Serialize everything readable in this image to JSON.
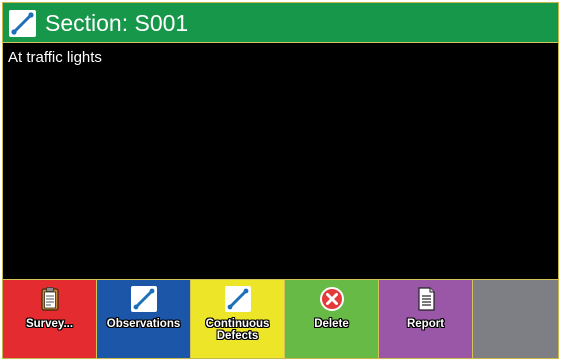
{
  "header": {
    "title": "Section: S001",
    "icon": "edit-line-icon"
  },
  "content": {
    "text": "At traffic lights"
  },
  "toolbar": {
    "buttons": [
      {
        "label": "Survey...",
        "icon": "clipboard-icon",
        "color": "#e42b2f"
      },
      {
        "label": "Observations",
        "icon": "edit-line-icon",
        "color": "#1c56a8"
      },
      {
        "label": "Continuous\nDefects",
        "icon": "edit-line-icon",
        "color": "#ede628"
      },
      {
        "label": "Delete",
        "icon": "delete-x-icon",
        "color": "#66ba45"
      },
      {
        "label": "Report",
        "icon": "document-icon",
        "color": "#9a56a7"
      }
    ],
    "empty_color": "#7d7f84"
  },
  "colors": {
    "header_bg": "#17974a",
    "content_bg": "#000000",
    "border": "#d4c457"
  }
}
